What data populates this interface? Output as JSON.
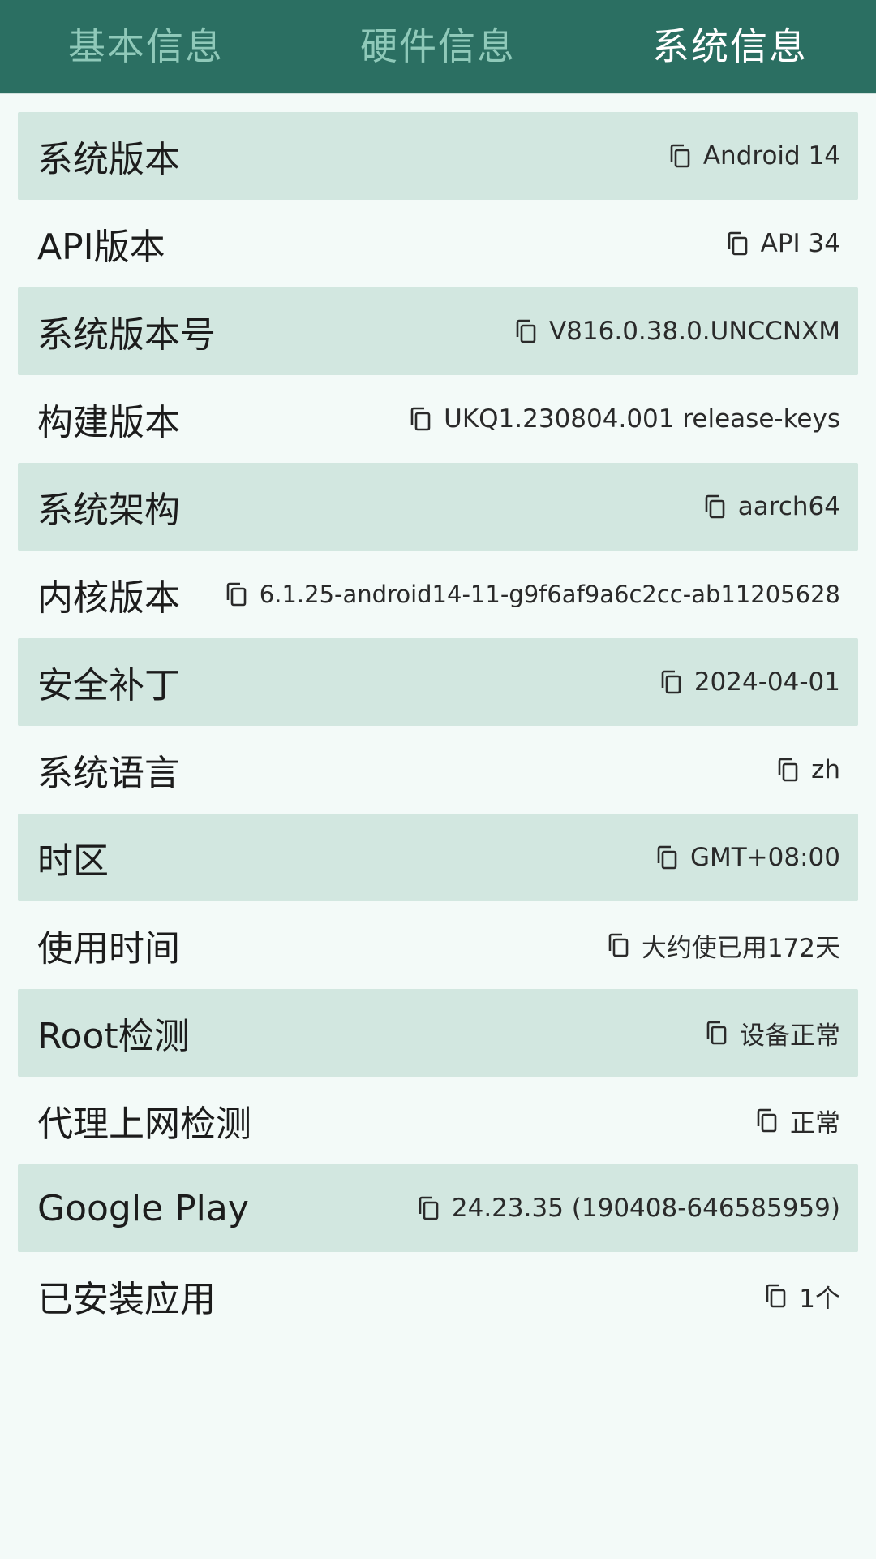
{
  "tabs": [
    {
      "label": "基本信息",
      "active": false
    },
    {
      "label": "硬件信息",
      "active": false
    },
    {
      "label": "系统信息",
      "active": true
    }
  ],
  "colors": {
    "tabbar": "#2b6f62",
    "tab_inactive": "#8fc9b9",
    "tab_active": "#ffffff",
    "row_shaded": "#d2e7e0",
    "page_bg": "#f3faf8"
  },
  "rows": [
    {
      "label": "系统版本",
      "value": "Android 14",
      "icon": "copy-icon"
    },
    {
      "label": "API版本",
      "value": "API 34",
      "icon": "copy-icon"
    },
    {
      "label": "系统版本号",
      "value": "V816.0.38.0.UNCCNXM",
      "icon": "copy-icon"
    },
    {
      "label": "构建版本",
      "value": "UKQ1.230804.001 release-keys",
      "icon": "copy-icon"
    },
    {
      "label": "系统架构",
      "value": "aarch64",
      "icon": "copy-icon"
    },
    {
      "label": "内核版本",
      "value": "6.1.25-android14-11-g9f6af9a6c2cc-ab11205628",
      "icon": "copy-icon"
    },
    {
      "label": "安全补丁",
      "value": "2024-04-01",
      "icon": "copy-icon"
    },
    {
      "label": "系统语言",
      "value": "zh",
      "icon": "copy-icon"
    },
    {
      "label": "时区",
      "value": "GMT+08:00",
      "icon": "copy-icon"
    },
    {
      "label": "使用时间",
      "value": "大约使已用172天",
      "icon": "copy-icon"
    },
    {
      "label": "Root检测",
      "value": "设备正常",
      "icon": "copy-icon"
    },
    {
      "label": "代理上网检测",
      "value": "正常",
      "icon": "copy-icon"
    },
    {
      "label": "Google Play",
      "value": "24.23.35 (190408-646585959)",
      "icon": "copy-icon"
    },
    {
      "label": "已安装应用",
      "value": "1个",
      "icon": "copy-icon"
    }
  ]
}
